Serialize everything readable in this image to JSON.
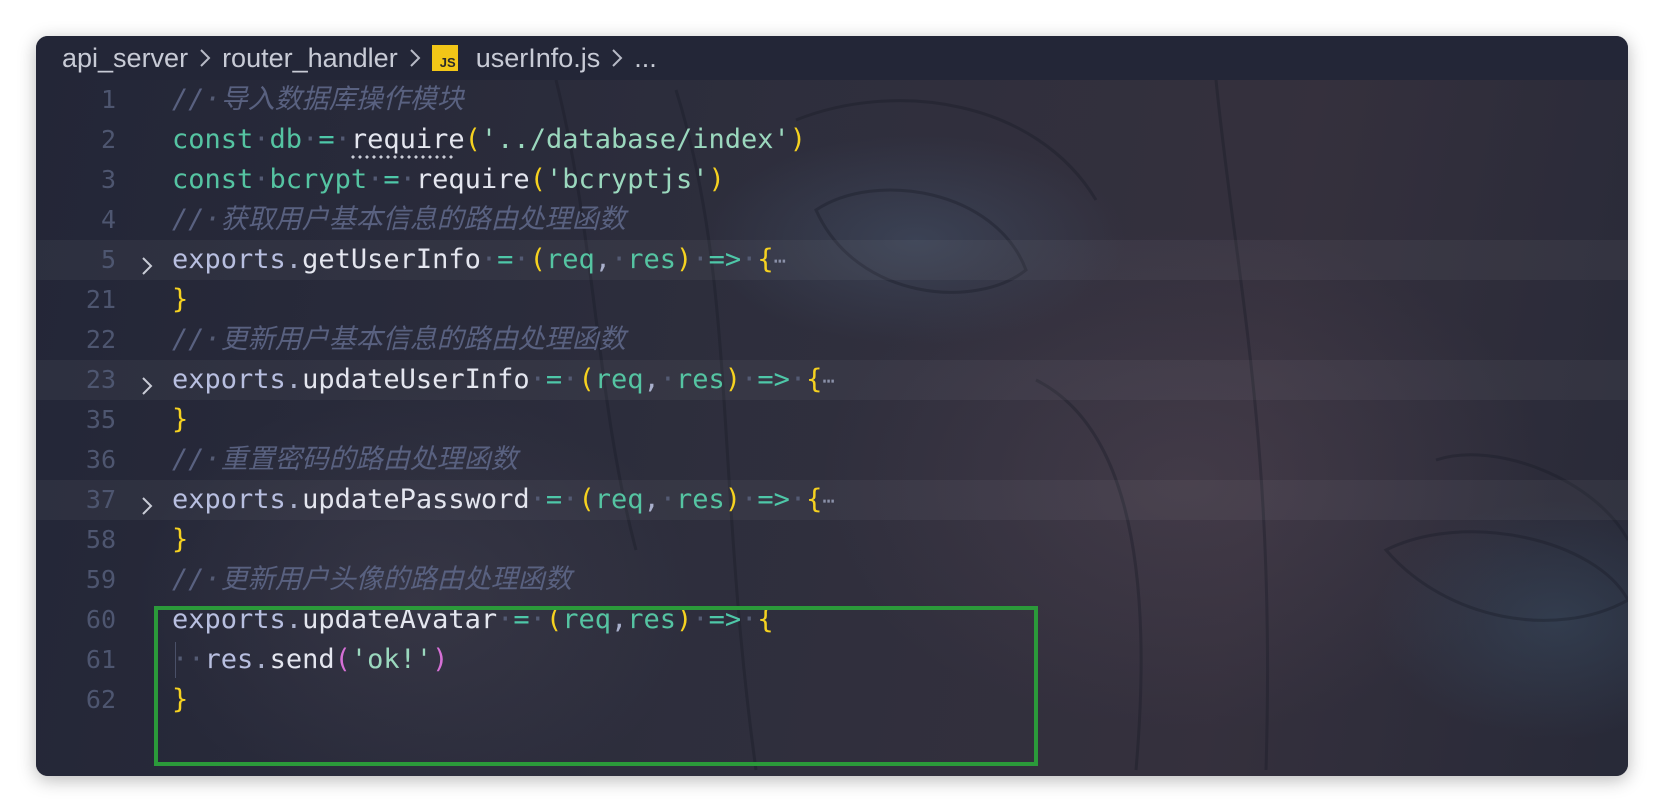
{
  "breadcrumb": {
    "items": [
      "api_server",
      "router_handler"
    ],
    "file_icon": "JS",
    "file_name": "userInfo.js",
    "more": "..."
  },
  "editor": {
    "language": "javascript",
    "lines": [
      {
        "num": "1",
        "text": "// 导入数据库操作模块"
      },
      {
        "num": "2",
        "text": "const db = require('../database/index')"
      },
      {
        "num": "3",
        "text": "const bcrypt = require('bcryptjs')"
      },
      {
        "num": "4",
        "text": "// 获取用户基本信息的路由处理函数"
      },
      {
        "num": "5",
        "text": "exports.getUserInfo = (req, res) => {…",
        "folded": true
      },
      {
        "num": "21",
        "text": "}"
      },
      {
        "num": "22",
        "text": "// 更新用户基本信息的路由处理函数"
      },
      {
        "num": "23",
        "text": "exports.updateUserInfo = (req, res) => {…",
        "folded": true
      },
      {
        "num": "35",
        "text": "}"
      },
      {
        "num": "36",
        "text": "// 重置密码的路由处理函数"
      },
      {
        "num": "37",
        "text": "exports.updatePassword = (req, res) => {…",
        "folded": true
      },
      {
        "num": "58",
        "text": "}"
      },
      {
        "num": "59",
        "text": "// 更新用户头像的路由处理函数"
      },
      {
        "num": "60",
        "text": "exports.updateAvatar = (req,res) => {"
      },
      {
        "num": "61",
        "text": "  res.send('ok!')"
      },
      {
        "num": "62",
        "text": "}"
      }
    ]
  },
  "colors": {
    "background": "#232637",
    "comment": "#596180",
    "keyword": "#55c4a2",
    "string": "#9bd8be",
    "bracket_level1": "#f6d220",
    "bracket_level2": "#d670d6",
    "highlight_box": "#2b9a3a"
  }
}
